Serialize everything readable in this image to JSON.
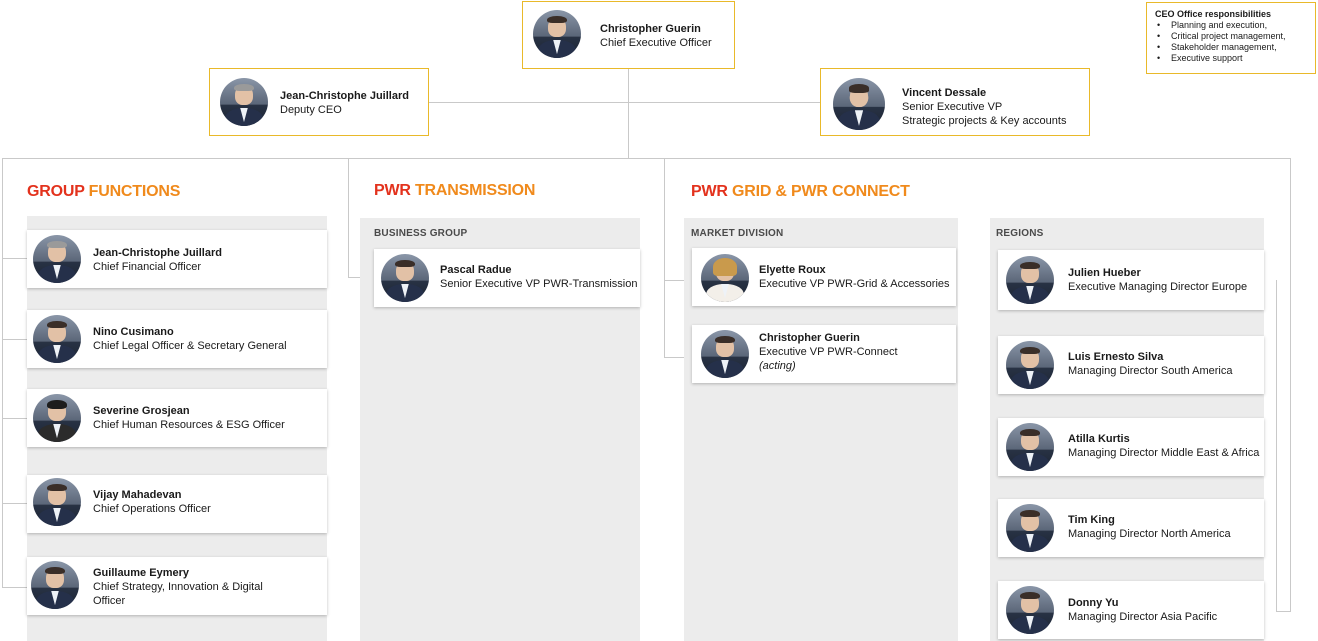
{
  "ceo": {
    "name": "Christopher Guerin",
    "title": "Chief Executive Officer"
  },
  "deputy": {
    "name": "Jean-Christophe Juillard",
    "title": "Deputy CEO"
  },
  "sevp": {
    "name": "Vincent Dessale",
    "title1": "Senior Executive VP",
    "title2": "Strategic projects & Key accounts"
  },
  "ceo_office": {
    "heading": "CEO Office responsibilities",
    "items": [
      "Planning and execution,",
      "Critical project management,",
      "Stakeholder management,",
      "Executive support"
    ]
  },
  "sections": {
    "group": {
      "a": "GROUP",
      "b": "FUNCTIONS"
    },
    "transmission": {
      "a": "PWR",
      "b": "TRANSMISSION"
    },
    "grid": {
      "a": "PWR",
      "b": "GRID & PWR CONNECT"
    }
  },
  "columns": {
    "business_group": "BUSINESS GROUP",
    "market_division": "MARKET DIVISION",
    "regions": "REGIONS"
  },
  "group_functions": [
    {
      "name": "Jean-Christophe Juillard",
      "title": "Chief Financial Officer"
    },
    {
      "name": "Nino Cusimano",
      "title": "Chief Legal Officer & Secretary General"
    },
    {
      "name": "Severine Grosjean",
      "title": "Chief Human Resources & ESG Officer"
    },
    {
      "name": "Vijay Mahadevan",
      "title": "Chief Operations Officer"
    },
    {
      "name": "Guillaume Eymery",
      "title": "Chief Strategy, Innovation & Digital",
      "title2": "Officer"
    }
  ],
  "transmission_people": [
    {
      "name": "Pascal Radue",
      "title": "Senior Executive VP PWR-Transmission"
    }
  ],
  "market_people": [
    {
      "name": "Elyette Roux",
      "title": "Executive VP PWR-Grid & Accessories"
    },
    {
      "name": "Christopher Guerin",
      "title": " Executive VP PWR-Connect",
      "note": "(acting)"
    }
  ],
  "regions_people": [
    {
      "name": "Julien Hueber",
      "title": "Executive Managing Director Europe"
    },
    {
      "name": "Luis Ernesto Silva",
      "title": "Managing Director South America"
    },
    {
      "name": "Atilla Kurtis",
      "title": "Managing Director Middle East & Africa"
    },
    {
      "name": "Tim King",
      "title": " Managing Director North America"
    },
    {
      "name": "Donny Yu",
      "title": "Managing Director Asia Pacific"
    }
  ],
  "colors": {
    "accent_red": "#e3321d",
    "accent_orange": "#f08a1c",
    "gold_border": "#e9b92a",
    "column_bg": "#ececec"
  }
}
